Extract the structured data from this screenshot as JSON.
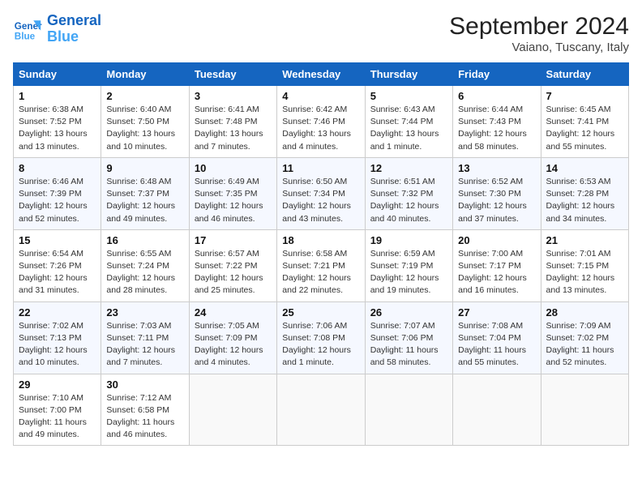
{
  "header": {
    "logo_line1": "General",
    "logo_line2": "Blue",
    "month": "September 2024",
    "location": "Vaiano, Tuscany, Italy"
  },
  "weekdays": [
    "Sunday",
    "Monday",
    "Tuesday",
    "Wednesday",
    "Thursday",
    "Friday",
    "Saturday"
  ],
  "weeks": [
    [
      {
        "num": "1",
        "sunrise": "Sunrise: 6:38 AM",
        "sunset": "Sunset: 7:52 PM",
        "daylight": "Daylight: 13 hours and 13 minutes."
      },
      {
        "num": "2",
        "sunrise": "Sunrise: 6:40 AM",
        "sunset": "Sunset: 7:50 PM",
        "daylight": "Daylight: 13 hours and 10 minutes."
      },
      {
        "num": "3",
        "sunrise": "Sunrise: 6:41 AM",
        "sunset": "Sunset: 7:48 PM",
        "daylight": "Daylight: 13 hours and 7 minutes."
      },
      {
        "num": "4",
        "sunrise": "Sunrise: 6:42 AM",
        "sunset": "Sunset: 7:46 PM",
        "daylight": "Daylight: 13 hours and 4 minutes."
      },
      {
        "num": "5",
        "sunrise": "Sunrise: 6:43 AM",
        "sunset": "Sunset: 7:44 PM",
        "daylight": "Daylight: 13 hours and 1 minute."
      },
      {
        "num": "6",
        "sunrise": "Sunrise: 6:44 AM",
        "sunset": "Sunset: 7:43 PM",
        "daylight": "Daylight: 12 hours and 58 minutes."
      },
      {
        "num": "7",
        "sunrise": "Sunrise: 6:45 AM",
        "sunset": "Sunset: 7:41 PM",
        "daylight": "Daylight: 12 hours and 55 minutes."
      }
    ],
    [
      {
        "num": "8",
        "sunrise": "Sunrise: 6:46 AM",
        "sunset": "Sunset: 7:39 PM",
        "daylight": "Daylight: 12 hours and 52 minutes."
      },
      {
        "num": "9",
        "sunrise": "Sunrise: 6:48 AM",
        "sunset": "Sunset: 7:37 PM",
        "daylight": "Daylight: 12 hours and 49 minutes."
      },
      {
        "num": "10",
        "sunrise": "Sunrise: 6:49 AM",
        "sunset": "Sunset: 7:35 PM",
        "daylight": "Daylight: 12 hours and 46 minutes."
      },
      {
        "num": "11",
        "sunrise": "Sunrise: 6:50 AM",
        "sunset": "Sunset: 7:34 PM",
        "daylight": "Daylight: 12 hours and 43 minutes."
      },
      {
        "num": "12",
        "sunrise": "Sunrise: 6:51 AM",
        "sunset": "Sunset: 7:32 PM",
        "daylight": "Daylight: 12 hours and 40 minutes."
      },
      {
        "num": "13",
        "sunrise": "Sunrise: 6:52 AM",
        "sunset": "Sunset: 7:30 PM",
        "daylight": "Daylight: 12 hours and 37 minutes."
      },
      {
        "num": "14",
        "sunrise": "Sunrise: 6:53 AM",
        "sunset": "Sunset: 7:28 PM",
        "daylight": "Daylight: 12 hours and 34 minutes."
      }
    ],
    [
      {
        "num": "15",
        "sunrise": "Sunrise: 6:54 AM",
        "sunset": "Sunset: 7:26 PM",
        "daylight": "Daylight: 12 hours and 31 minutes."
      },
      {
        "num": "16",
        "sunrise": "Sunrise: 6:55 AM",
        "sunset": "Sunset: 7:24 PM",
        "daylight": "Daylight: 12 hours and 28 minutes."
      },
      {
        "num": "17",
        "sunrise": "Sunrise: 6:57 AM",
        "sunset": "Sunset: 7:22 PM",
        "daylight": "Daylight: 12 hours and 25 minutes."
      },
      {
        "num": "18",
        "sunrise": "Sunrise: 6:58 AM",
        "sunset": "Sunset: 7:21 PM",
        "daylight": "Daylight: 12 hours and 22 minutes."
      },
      {
        "num": "19",
        "sunrise": "Sunrise: 6:59 AM",
        "sunset": "Sunset: 7:19 PM",
        "daylight": "Daylight: 12 hours and 19 minutes."
      },
      {
        "num": "20",
        "sunrise": "Sunrise: 7:00 AM",
        "sunset": "Sunset: 7:17 PM",
        "daylight": "Daylight: 12 hours and 16 minutes."
      },
      {
        "num": "21",
        "sunrise": "Sunrise: 7:01 AM",
        "sunset": "Sunset: 7:15 PM",
        "daylight": "Daylight: 12 hours and 13 minutes."
      }
    ],
    [
      {
        "num": "22",
        "sunrise": "Sunrise: 7:02 AM",
        "sunset": "Sunset: 7:13 PM",
        "daylight": "Daylight: 12 hours and 10 minutes."
      },
      {
        "num": "23",
        "sunrise": "Sunrise: 7:03 AM",
        "sunset": "Sunset: 7:11 PM",
        "daylight": "Daylight: 12 hours and 7 minutes."
      },
      {
        "num": "24",
        "sunrise": "Sunrise: 7:05 AM",
        "sunset": "Sunset: 7:09 PM",
        "daylight": "Daylight: 12 hours and 4 minutes."
      },
      {
        "num": "25",
        "sunrise": "Sunrise: 7:06 AM",
        "sunset": "Sunset: 7:08 PM",
        "daylight": "Daylight: 12 hours and 1 minute."
      },
      {
        "num": "26",
        "sunrise": "Sunrise: 7:07 AM",
        "sunset": "Sunset: 7:06 PM",
        "daylight": "Daylight: 11 hours and 58 minutes."
      },
      {
        "num": "27",
        "sunrise": "Sunrise: 7:08 AM",
        "sunset": "Sunset: 7:04 PM",
        "daylight": "Daylight: 11 hours and 55 minutes."
      },
      {
        "num": "28",
        "sunrise": "Sunrise: 7:09 AM",
        "sunset": "Sunset: 7:02 PM",
        "daylight": "Daylight: 11 hours and 52 minutes."
      }
    ],
    [
      {
        "num": "29",
        "sunrise": "Sunrise: 7:10 AM",
        "sunset": "Sunset: 7:00 PM",
        "daylight": "Daylight: 11 hours and 49 minutes."
      },
      {
        "num": "30",
        "sunrise": "Sunrise: 7:12 AM",
        "sunset": "Sunset: 6:58 PM",
        "daylight": "Daylight: 11 hours and 46 minutes."
      },
      null,
      null,
      null,
      null,
      null
    ]
  ]
}
